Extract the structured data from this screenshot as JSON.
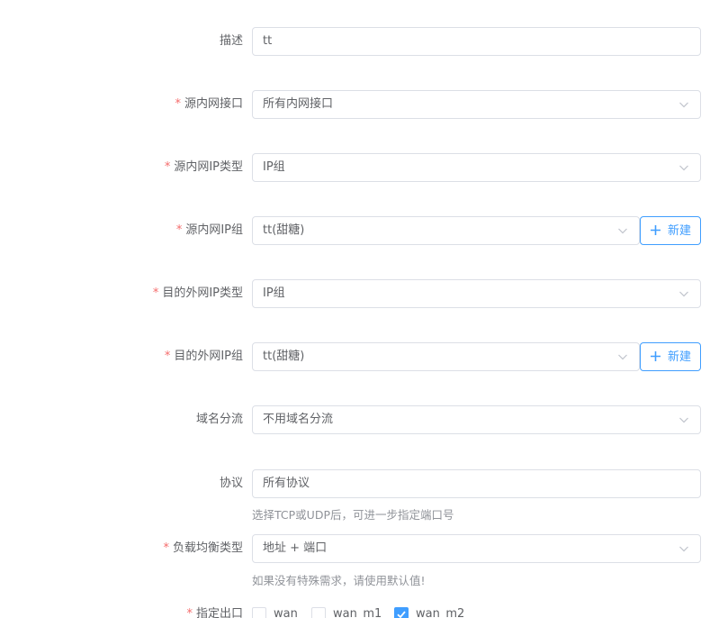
{
  "fields": {
    "desc": {
      "label": "描述",
      "value": "tt"
    },
    "src_interface": {
      "label": "源内网接口",
      "value": "所有内网接口"
    },
    "src_ip_type": {
      "label": "源内网IP类型",
      "value": "IP组"
    },
    "src_ip_group": {
      "label": "源内网IP组",
      "value": "tt(甜糖)",
      "new_label": "新建"
    },
    "dst_ip_type": {
      "label": "目的外网IP类型",
      "value": "IP组"
    },
    "dst_ip_group": {
      "label": "目的外网IP组",
      "value": "tt(甜糖)",
      "new_label": "新建"
    },
    "domain_split": {
      "label": "域名分流",
      "value": "不用域名分流"
    },
    "protocol": {
      "label": "协议",
      "value": "所有协议",
      "hint": "选择TCP或UDP后，可进一步指定端口号"
    },
    "lb_type": {
      "label": "负载均衡类型",
      "value": "地址 + 端口",
      "hint": "如果没有特殊需求，请使用默认值!"
    },
    "outlet": {
      "label": "指定出口"
    }
  },
  "required_mark": "*",
  "outlets": [
    {
      "name": "wan",
      "checked": false
    },
    {
      "name": "wan_m1",
      "checked": false
    },
    {
      "name": "wan_m2",
      "checked": true
    }
  ],
  "colors": {
    "accent": "#409eff",
    "required": "#f56c6c",
    "border": "#dcdfe6",
    "text": "#606266",
    "hint": "#909399"
  }
}
